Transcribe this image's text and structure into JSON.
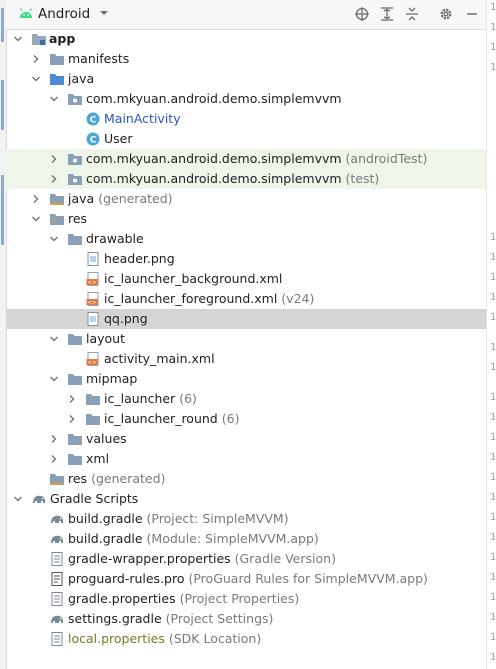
{
  "header": {
    "view_title": "Android"
  },
  "tree": [
    {
      "name": "app",
      "hint": ""
    },
    {
      "name": "manifests",
      "hint": ""
    },
    {
      "name": "java",
      "hint": ""
    },
    {
      "name": "com.mkyuan.android.demo.simplemvvm",
      "hint": ""
    },
    {
      "name": "MainActivity",
      "hint": ""
    },
    {
      "name": "User",
      "hint": ""
    },
    {
      "name": "com.mkyuan.android.demo.simplemvvm",
      "hint": "(androidTest)"
    },
    {
      "name": "com.mkyuan.android.demo.simplemvvm",
      "hint": "(test)"
    },
    {
      "name": "java",
      "hint": "(generated)"
    },
    {
      "name": "res",
      "hint": ""
    },
    {
      "name": "drawable",
      "hint": ""
    },
    {
      "name": "header.png",
      "hint": ""
    },
    {
      "name": "ic_launcher_background.xml",
      "hint": ""
    },
    {
      "name": "ic_launcher_foreground.xml",
      "hint": "(v24)"
    },
    {
      "name": "qq.png",
      "hint": ""
    },
    {
      "name": "layout",
      "hint": ""
    },
    {
      "name": "activity_main.xml",
      "hint": ""
    },
    {
      "name": "mipmap",
      "hint": ""
    },
    {
      "name": "ic_launcher",
      "hint": "(6)"
    },
    {
      "name": "ic_launcher_round",
      "hint": "(6)"
    },
    {
      "name": "values",
      "hint": ""
    },
    {
      "name": "xml",
      "hint": ""
    },
    {
      "name": "res",
      "hint": "(generated)"
    },
    {
      "name": "Gradle Scripts",
      "hint": ""
    },
    {
      "name": "build.gradle",
      "hint": "(Project: SimpleMVVM)"
    },
    {
      "name": "build.gradle",
      "hint": "(Module: SimpleMVVM.app)"
    },
    {
      "name": "gradle-wrapper.properties",
      "hint": "(Gradle Version)"
    },
    {
      "name": "proguard-rules.pro",
      "hint": "(ProGuard Rules for SimpleMVVM.app)"
    },
    {
      "name": "gradle.properties",
      "hint": "(Project Properties)"
    },
    {
      "name": "settings.gradle",
      "hint": "(Project Settings)"
    },
    {
      "name": "local.properties",
      "hint": "(SDK Location)"
    }
  ],
  "gutter_marks": [
    "1",
    "1",
    "1",
    "1",
    "1",
    "1",
    "1",
    "1",
    "1",
    "1",
    "1",
    "1",
    "1",
    "1",
    "1",
    "1",
    "1",
    "1",
    "1",
    "1",
    "1",
    "1",
    "1",
    "1",
    "1"
  ],
  "colors": {
    "selected_row": "#d5d5d5",
    "test_row": "#edf6e8",
    "class_text": "#2f55c7",
    "local_props_text": "#7a7a2a"
  }
}
